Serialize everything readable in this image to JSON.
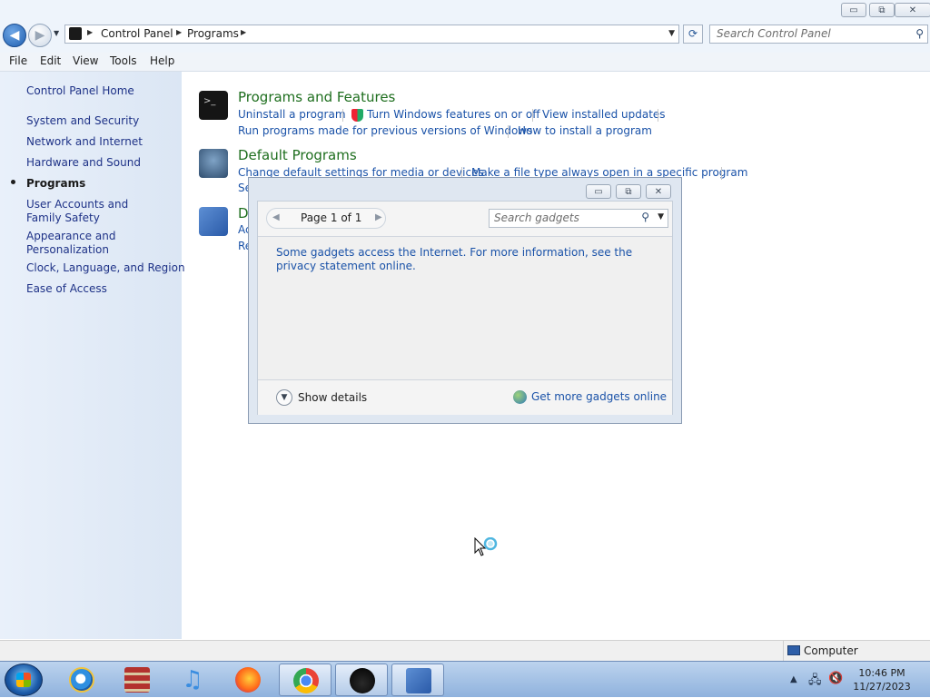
{
  "window": {
    "controls": {
      "minimize": "▭",
      "maximize": "⧉",
      "close": "✕"
    }
  },
  "navigation": {
    "back_glyph": "◀",
    "forward_glyph": "▶",
    "breadcrumbs": [
      "Control Panel",
      "Programs"
    ],
    "search_placeholder": "Search Control Panel"
  },
  "menu": [
    "File",
    "Edit",
    "View",
    "Tools",
    "Help"
  ],
  "sidebar": {
    "home": "Control Panel Home",
    "items": [
      {
        "label": "System and Security"
      },
      {
        "label": "Network and Internet"
      },
      {
        "label": "Hardware and Sound"
      },
      {
        "label": "Programs",
        "active": true
      },
      {
        "label": "User Accounts and Family Safety"
      },
      {
        "label": "Appearance and Personalization"
      },
      {
        "label": "Clock, Language, and Region"
      },
      {
        "label": "Ease of Access"
      }
    ]
  },
  "categories": [
    {
      "title": "Programs and Features",
      "icon": "programs-features-icon",
      "links": [
        "Uninstall a program",
        "Turn Windows features on or off",
        "View installed updates",
        "Run programs made for previous versions of Windows",
        "How to install a program"
      ]
    },
    {
      "title": "Default Programs",
      "icon": "default-programs-icon",
      "links": [
        "Change default settings for media or devices",
        "Make a file type always open in a specific program",
        "Se"
      ]
    },
    {
      "title": "D",
      "icon": "desktop-gadgets-icon",
      "links": [
        "Ac",
        "Re"
      ]
    }
  ],
  "gadget_dialog": {
    "pager": "Page 1 of 1",
    "search_placeholder": "Search gadgets",
    "info": "Some gadgets access the Internet.  For more information, see the privacy statement online.",
    "show_details": "Show details",
    "get_more": "Get more gadgets online"
  },
  "statusbar": {
    "computer": "Computer"
  },
  "taskbar": {
    "apps": [
      "Internet Explorer",
      "Archive Manager",
      "iTunes",
      "Firefox",
      "Chrome",
      "Explorer Hat",
      "Control Panel"
    ],
    "clock_time": "10:46 PM",
    "clock_date": "11/27/2023"
  },
  "colors": {
    "link": "#1a52a8",
    "category_title": "#1e6e1e",
    "sidebar_link": "#1e3287"
  }
}
